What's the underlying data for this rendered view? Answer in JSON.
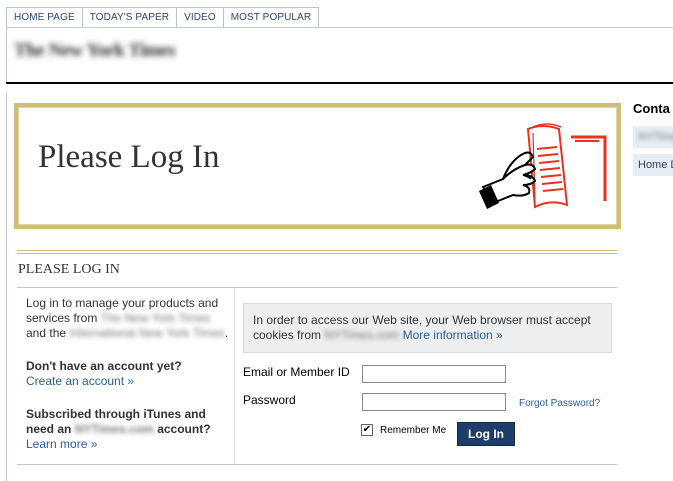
{
  "nav": {
    "tabs": [
      "Home Page",
      "Today's Paper",
      "Video",
      "Most Popular"
    ]
  },
  "header": {
    "masthead": "The New York Times"
  },
  "banner": {
    "title": "Please Log In"
  },
  "section": {
    "title": "Please Log In"
  },
  "left_col": {
    "intro_1": "Log in to manage your products and services from",
    "intro_blur_1": "The New York Times",
    "intro_2": "and the",
    "intro_blur_2": "International New York Times",
    "intro_period": ".",
    "no_account_q": "Don't have an account yet?",
    "create_link": "Create an account »",
    "itunes_q1": "Subscribed through iTunes and need an",
    "itunes_blur": "NYTimes.com",
    "itunes_q2": "account?",
    "learn_link": "Learn more »"
  },
  "notice": {
    "text_1": "In order to access our Web site, your Web browser must accept cookies from",
    "blur_domain": "NYTimes.com",
    "more_link": "More information »"
  },
  "form": {
    "email_label": "Email or Member ID",
    "email_value": "",
    "password_label": "Password",
    "password_value": "",
    "forgot_link": "Forgot Password?",
    "remember_label": "Remember Me",
    "remember_checked": true,
    "login_button": "Log In"
  },
  "sidebar": {
    "title": "Conta",
    "items": [
      "NYTimes",
      "Home D"
    ]
  },
  "colors": {
    "banner_border": "#cdbf78",
    "link": "#2a5d9f",
    "button": "#1f3d6b"
  }
}
